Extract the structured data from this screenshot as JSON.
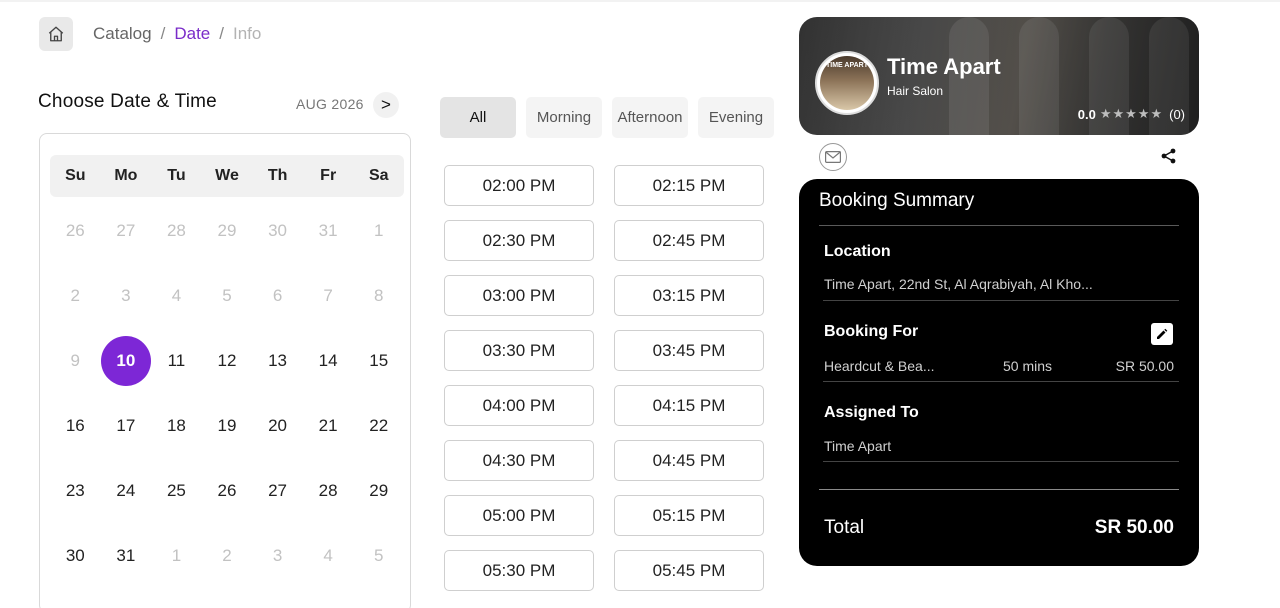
{
  "breadcrumb": {
    "home_icon": "home-icon",
    "items": [
      "Catalog",
      "Date",
      "Info"
    ],
    "separator": "/"
  },
  "calendar": {
    "title": "Choose Date & Time",
    "month": "AUG 2026",
    "next_label": ">",
    "weekdays": [
      "Su",
      "Mo",
      "Tu",
      "We",
      "Th",
      "Fr",
      "Sa"
    ],
    "weeks": [
      [
        "26",
        "27",
        "28",
        "29",
        "30",
        "31",
        "1"
      ],
      [
        "2",
        "3",
        "4",
        "5",
        "6",
        "7",
        "8"
      ],
      [
        "9",
        "10",
        "11",
        "12",
        "13",
        "14",
        "15"
      ],
      [
        "16",
        "17",
        "18",
        "19",
        "20",
        "21",
        "22"
      ],
      [
        "23",
        "24",
        "25",
        "26",
        "27",
        "28",
        "29"
      ],
      [
        "30",
        "31",
        "1",
        "2",
        "3",
        "4",
        "5"
      ]
    ],
    "selected_day": "10",
    "accent_color": "#7d27d6"
  },
  "filters": {
    "items": [
      "All",
      "Morning",
      "Afternoon",
      "Evening"
    ],
    "active": "All"
  },
  "slots": [
    "02:00 PM",
    "02:15 PM",
    "02:30 PM",
    "02:45 PM",
    "03:00 PM",
    "03:15 PM",
    "03:30 PM",
    "03:45 PM",
    "04:00 PM",
    "04:15 PM",
    "04:30 PM",
    "04:45 PM",
    "05:00 PM",
    "05:15 PM",
    "05:30 PM",
    "05:45 PM"
  ],
  "salon": {
    "name": "Time Apart",
    "type": "Hair Salon",
    "logo_text": "TIME APART",
    "rating": "0.0",
    "stars": "★★★★★",
    "reviews": "(0)",
    "mail_icon": "mail-icon",
    "share_icon": "share-icon"
  },
  "summary": {
    "title": "Booking Summary",
    "location_label": "Location",
    "location_value": "Time Apart, 22nd St, Al Aqrabiyah, Al Kho...",
    "booking_for_label": "Booking For",
    "service": "Heardcut & Bea...",
    "duration": "50 mins",
    "price": "SR 50.00",
    "edit_icon": "pencil-icon",
    "assigned_label": "Assigned To",
    "assigned_value": "Time Apart",
    "total_label": "Total",
    "total_value": "SR 50.00"
  }
}
